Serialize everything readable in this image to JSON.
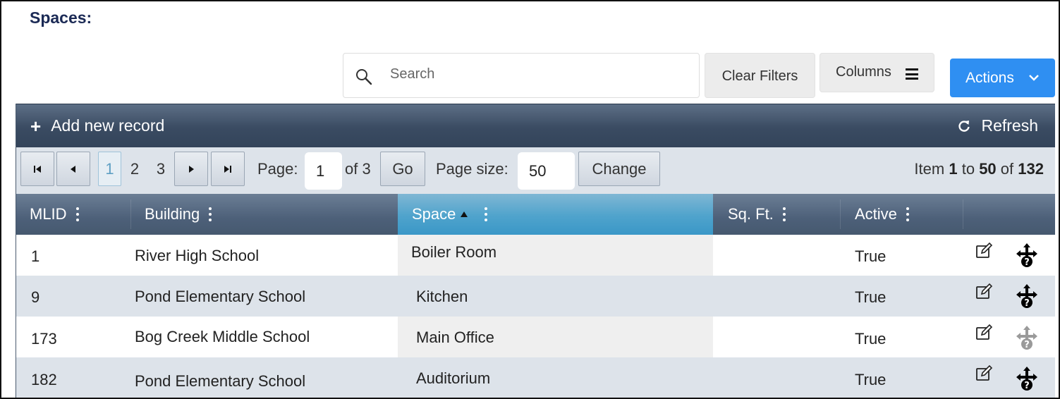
{
  "page": {
    "title": "Spaces:"
  },
  "search": {
    "placeholder": "Search",
    "value": ""
  },
  "toolbar_buttons": {
    "clear_filters": "Clear Filters",
    "columns": "Columns",
    "actions": "Actions"
  },
  "grid_toolbar": {
    "add_label": "Add new record",
    "refresh_label": "Refresh"
  },
  "pager": {
    "pages": [
      "1",
      "2",
      "3"
    ],
    "current_page": "1",
    "page_label": "Page:",
    "page_input": "1",
    "of_label": "of 3",
    "go_label": "Go",
    "page_size_label": "Page size:",
    "page_size": "50",
    "change_label": "Change",
    "item_prefix": "Item",
    "item_from": "1",
    "item_to_word": "to",
    "item_to": "50",
    "item_of_word": "of",
    "item_total": "132"
  },
  "columns": [
    {
      "label": "MLID"
    },
    {
      "label": "Building"
    },
    {
      "label": "Space",
      "sorted": "ascending"
    },
    {
      "label": "Sq. Ft."
    },
    {
      "label": "Active"
    }
  ],
  "rows": [
    {
      "mlid": "1",
      "building": "River High School",
      "space": "Boiler Room",
      "sqft": "",
      "active": "True",
      "move_enabled": true
    },
    {
      "mlid": "9",
      "building": "Pond Elementary School",
      "space": "Kitchen",
      "sqft": "",
      "active": "True",
      "move_enabled": true
    },
    {
      "mlid": "173",
      "building": "Bog Creek Middle School",
      "space": "Main Office",
      "sqft": "",
      "active": "True",
      "move_enabled": false
    },
    {
      "mlid": "182",
      "building": "Pond Elementary School",
      "space": "Auditorium",
      "sqft": "",
      "active": "True",
      "move_enabled": true
    }
  ],
  "colors": {
    "title": "#1b2a55",
    "actions_button": "#2f8ff2",
    "toolbar": "#3a4b62",
    "sorted_header": "#4fa3cc",
    "alt_row": "#dde3ea"
  },
  "icons": {
    "search": "search-icon",
    "columns": "hamburger-icon",
    "actions": "chevron-down-icon",
    "add": "plus-icon",
    "refresh": "refresh-icon",
    "edit": "edit-icon",
    "move": "move-question-icon"
  }
}
